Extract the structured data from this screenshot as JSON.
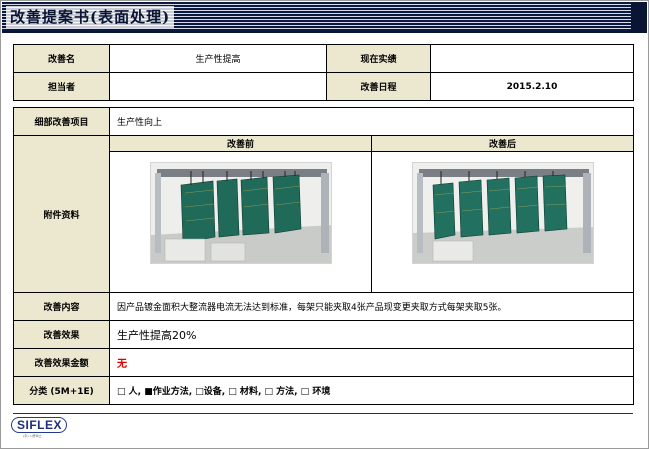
{
  "header": {
    "title": "改善提案书(表面处理)"
  },
  "info": {
    "name_label": "改善名",
    "name_value": "生产性提高",
    "actual_label": "现在实绩",
    "actual_value": "",
    "owner_label": "担当者",
    "owner_value": "",
    "date_label": "改善日程",
    "date_value": "2015.2.10"
  },
  "detail": {
    "item_label": "细部改善项目",
    "item_value": "生产性向上",
    "attach_label": "附件资料",
    "before_label": "改善前",
    "after_label": "改善后",
    "content_label": "改善内容",
    "content_value": "因产品镀金面积大整流器电流无法达到标准，每架只能夹取4张产品现变更夹取方式每架夹取5张。",
    "effect_label": "改善效果",
    "effect_value": "生产性提高20%",
    "amount_label": "改善效果金额",
    "amount_value": "无",
    "category_label": "分类 (5M+1E)",
    "category_value": "□ 人, ■作业方法, □设备, □ 材料, □ 方法, □ 环境"
  },
  "logo": {
    "text": "SIFLEX",
    "sub": "(주) 시플렉스"
  },
  "photos": {
    "before_icon": "plating-rack-photo",
    "after_icon": "plating-rack-photo"
  },
  "colors": {
    "label_bg": "#ece8cf",
    "title_navy": "#0a1433",
    "amount_red": "#e00000"
  }
}
